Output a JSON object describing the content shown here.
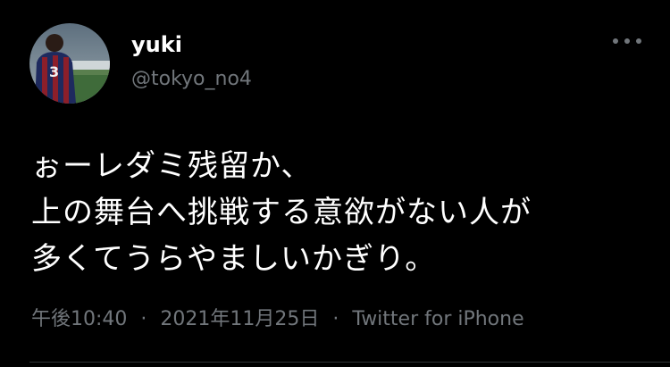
{
  "user": {
    "display_name": "yuki",
    "handle": "@tokyo_no4",
    "avatar_icon": "profile-photo"
  },
  "tweet": {
    "lines": [
      "ぉーレダミ残留か、",
      "上の舞台へ挑戦する意欲がない人が",
      "多くてうらやましいかぎり。"
    ]
  },
  "meta": {
    "time": "午後10:40",
    "date": "2021年11月25日",
    "separator": "·",
    "source": "Twitter for iPhone"
  },
  "icons": {
    "more": "more-horizontal-icon"
  },
  "colors": {
    "background": "#000000",
    "text": "#ffffff",
    "secondary": "#71767b",
    "divider": "#2f3336"
  }
}
